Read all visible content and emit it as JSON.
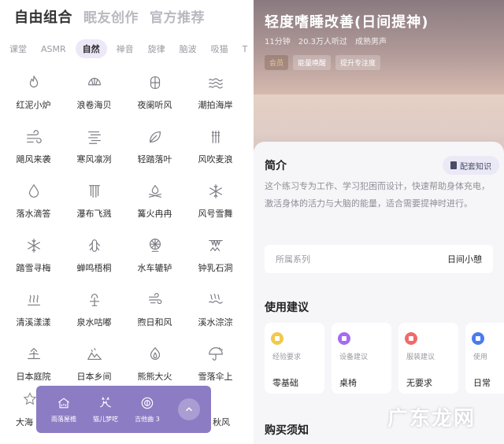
{
  "left": {
    "tabs": [
      "自由组合",
      "眠友创作",
      "官方推荐"
    ],
    "categories": [
      "课堂",
      "ASMR",
      "自然",
      "禅音",
      "旋律",
      "脑波",
      "吸猫",
      "T"
    ],
    "sounds": [
      {
        "label": "红泥小炉",
        "icon": "flame-icon"
      },
      {
        "label": "浪卷海贝",
        "icon": "shell-icon"
      },
      {
        "label": "夜阑听风",
        "icon": "window-icon"
      },
      {
        "label": "潮拍海岸",
        "icon": "waves-icon"
      },
      {
        "label": "飓风来袭",
        "icon": "wind-icon"
      },
      {
        "label": "寒风凛冽",
        "icon": "wind-lines-icon"
      },
      {
        "label": "轻踏落叶",
        "icon": "leaf-icon"
      },
      {
        "label": "风吹麦浪",
        "icon": "wheat-icon"
      },
      {
        "label": "落水滴答",
        "icon": "drop-icon"
      },
      {
        "label": "瀑布飞溅",
        "icon": "waterfall-icon"
      },
      {
        "label": "篝火冉冉",
        "icon": "campfire-icon"
      },
      {
        "label": "风号雪舞",
        "icon": "snowflake-icon"
      },
      {
        "label": "踏雪寻梅",
        "icon": "snowflake-icon"
      },
      {
        "label": "蝉鸣梧桐",
        "icon": "cicada-icon"
      },
      {
        "label": "水车辘轳",
        "icon": "waterwheel-icon"
      },
      {
        "label": "钟乳石洞",
        "icon": "cave-icon"
      },
      {
        "label": "清溪漾漾",
        "icon": "stream-icon"
      },
      {
        "label": "泉水咕嘟",
        "icon": "spring-icon"
      },
      {
        "label": "煦日和风",
        "icon": "breeze-icon"
      },
      {
        "label": "溪水淙淙",
        "icon": "creek-icon"
      },
      {
        "label": "日本庭院",
        "icon": "garden-icon"
      },
      {
        "label": "日本乡间",
        "icon": "countryside-icon"
      },
      {
        "label": "熊熊大火",
        "icon": "bonfire-icon"
      },
      {
        "label": "雪落伞上",
        "icon": "umbrella-icon"
      }
    ],
    "partial_bottom_left": "大海",
    "partial_bottom_right": "秋风",
    "player": {
      "items": [
        {
          "label": "雨落屋檐",
          "icon": "house-rain-icon"
        },
        {
          "label": "猫儿梦呓",
          "icon": "cat-icon"
        },
        {
          "label": "吉他曲 3",
          "icon": "guitar-icon"
        }
      ],
      "expand_icon": "chevron-up-icon"
    }
  },
  "right": {
    "title": "轻度嗜睡改善(日间提神)",
    "meta": [
      "11分钟",
      "20.3万人听过",
      "成熟男声"
    ],
    "tags": [
      "会员",
      "能量唤醒",
      "提升专注度"
    ],
    "intro_title": "简介",
    "knowledge_button": "配套知识",
    "description": "这个练习专为工作、学习犯困而设计，快速帮助身体充电，激活身体的活力与大脑的能量，适合需要提神时进行。",
    "series_label": "所属系列",
    "series_value": "日间小憩",
    "advice_title": "使用建议",
    "advice": [
      {
        "key": "经验要求",
        "value": "零基础",
        "color": "#f2c94c"
      },
      {
        "key": "设备建议",
        "value": "桌椅",
        "color": "#a56cf0"
      },
      {
        "key": "服装建议",
        "value": "无要求",
        "color": "#f06a6a"
      },
      {
        "key": "使用",
        "value": "日常",
        "color": "#4a7cf0"
      }
    ],
    "purchase_title": "购买须知",
    "watermark": "广东龙网"
  }
}
